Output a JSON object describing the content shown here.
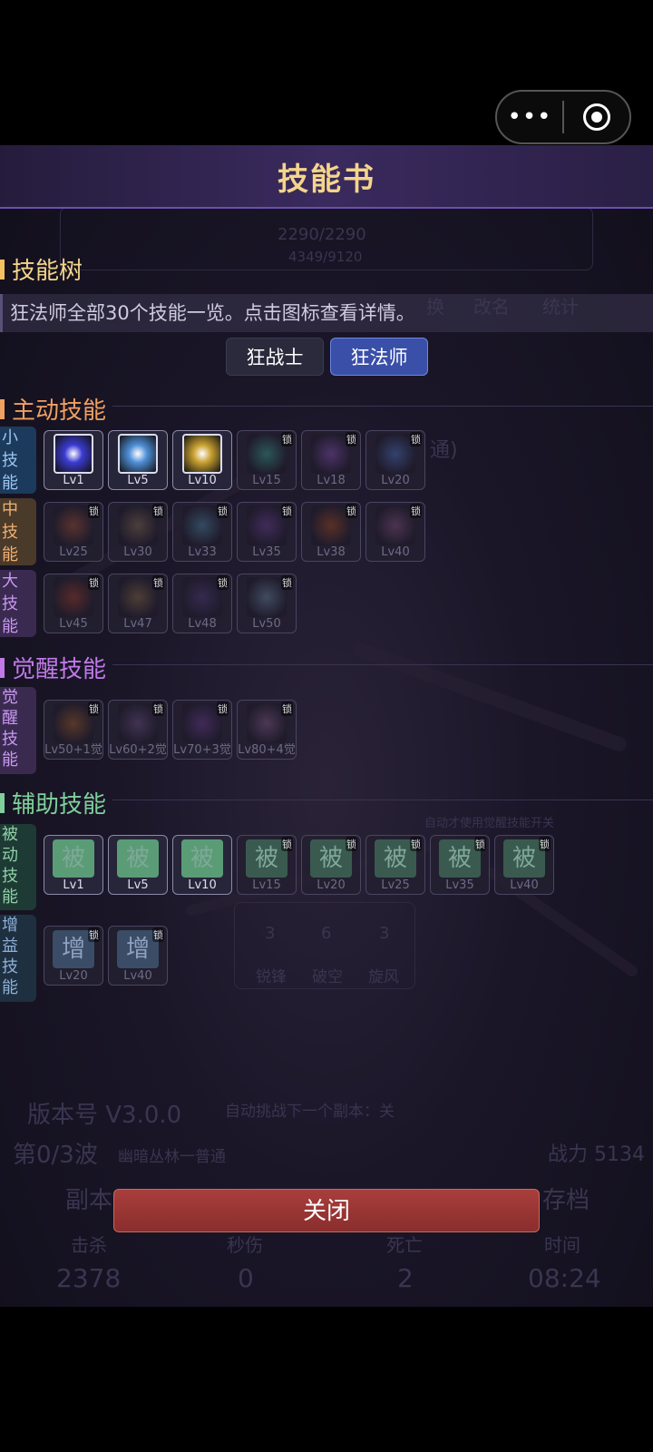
{
  "capsule": {
    "more": "•••"
  },
  "header": {
    "title": "技能书"
  },
  "tree": {
    "title": "技能树",
    "description": "狂法师全部30个技能一览。点击图标查看详情。",
    "classes": [
      "狂战士",
      "狂法师"
    ],
    "selected_class": "狂法师"
  },
  "sections": {
    "active": {
      "title": "主动技能",
      "color": "#f0a060"
    },
    "awaken": {
      "title": "觉醒技能",
      "color": "#c07ae8"
    },
    "support": {
      "title": "辅助技能",
      "color": "#7fd09a"
    }
  },
  "rows": {
    "small": {
      "label": "小\n技\n能"
    },
    "medium": {
      "label": "中\n技\n能"
    },
    "large": {
      "label": "大\n技\n能"
    },
    "awaken": {
      "label": "觉\n醒\n技\n能"
    },
    "passive": {
      "label": "被\n动\n技\n能"
    },
    "buff": {
      "label": "增\n益\n技\n能"
    }
  },
  "lock_text": "锁",
  "skills": {
    "small": [
      {
        "lv": "Lv1",
        "unlocked": true,
        "icon": "blue-claw-icon",
        "color": "#3a3bd0"
      },
      {
        "lv": "Lv5",
        "unlocked": true,
        "icon": "ice-shard-icon",
        "color": "#4f8fd8"
      },
      {
        "lv": "Lv10",
        "unlocked": true,
        "icon": "lightning-icon",
        "color": "#c8a030"
      },
      {
        "lv": "Lv15",
        "unlocked": false,
        "icon": "vortex-icon",
        "color": "#2f6a66"
      },
      {
        "lv": "Lv18",
        "unlocked": false,
        "icon": "purple-burst-icon",
        "color": "#5b3a7a"
      },
      {
        "lv": "Lv20",
        "unlocked": false,
        "icon": "comet-icon",
        "color": "#3a4e82"
      }
    ],
    "medium": [
      {
        "lv": "Lv25",
        "unlocked": false,
        "icon": "fire-orb-icon",
        "color": "#6a3a30"
      },
      {
        "lv": "Lv30",
        "unlocked": false,
        "icon": "spike-burst-icon",
        "color": "#5a4a40"
      },
      {
        "lv": "Lv33",
        "unlocked": false,
        "icon": "whirlwind-icon",
        "color": "#3a5870"
      },
      {
        "lv": "Lv35",
        "unlocked": false,
        "icon": "dark-slash-icon",
        "color": "#4a3068"
      },
      {
        "lv": "Lv38",
        "unlocked": false,
        "icon": "flame-icon",
        "color": "#6a3624"
      },
      {
        "lv": "Lv40",
        "unlocked": false,
        "icon": "spiral-icon",
        "color": "#5a3a5a"
      }
    ],
    "large": [
      {
        "lv": "Lv45",
        "unlocked": false,
        "icon": "fire-ring-icon",
        "color": "#6a2e28"
      },
      {
        "lv": "Lv47",
        "unlocked": false,
        "icon": "meteor-icon",
        "color": "#5c4838"
      },
      {
        "lv": "Lv48",
        "unlocked": false,
        "icon": "shadow-orb-icon",
        "color": "#3a2e5a"
      },
      {
        "lv": "Lv50",
        "unlocked": false,
        "icon": "frost-nova-icon",
        "color": "#4a5a70"
      }
    ],
    "awaken": [
      {
        "lv": "Lv50+1觉",
        "unlocked": false,
        "icon": "blade-storm-icon",
        "color": "#6a4028"
      },
      {
        "lv": "Lv60+2觉",
        "unlocked": false,
        "icon": "demon-mask-icon",
        "color": "#4a3a5e"
      },
      {
        "lv": "Lv70+3觉",
        "unlocked": false,
        "icon": "arcane-rune-icon",
        "color": "#4a2e66"
      },
      {
        "lv": "Lv80+4觉",
        "unlocked": false,
        "icon": "phoenix-icon",
        "color": "#5a4060"
      }
    ],
    "passive": [
      {
        "lv": "Lv1",
        "unlocked": true,
        "text": "被"
      },
      {
        "lv": "Lv5",
        "unlocked": true,
        "text": "被"
      },
      {
        "lv": "Lv10",
        "unlocked": true,
        "text": "被"
      },
      {
        "lv": "Lv15",
        "unlocked": false,
        "text": "被"
      },
      {
        "lv": "Lv20",
        "unlocked": false,
        "text": "被"
      },
      {
        "lv": "Lv25",
        "unlocked": false,
        "text": "被"
      },
      {
        "lv": "Lv35",
        "unlocked": false,
        "text": "被"
      },
      {
        "lv": "Lv40",
        "unlocked": false,
        "text": "被"
      }
    ],
    "buff": [
      {
        "lv": "Lv20",
        "unlocked": false,
        "text": "增"
      },
      {
        "lv": "Lv40",
        "unlocked": false,
        "text": "增"
      }
    ]
  },
  "background_ui": {
    "hp": "2290/2290",
    "exp": "4349/9120",
    "tabs": [
      "换",
      "改名",
      "统计"
    ],
    "dungeon_hint": "通)",
    "awaken_switch": "自动才使用觉醒技能开关",
    "mini_skills": [
      {
        "count": "3",
        "name": "锐锋"
      },
      {
        "count": "6",
        "name": "破空"
      },
      {
        "count": "3",
        "name": "旋风"
      }
    ],
    "version": "版本号 V3.0.0",
    "auto_challenge": "自动挑战下一个副本：关",
    "wave": "第0/3波",
    "wave_place": "幽暗丛林一普通",
    "power": "战力 5134",
    "buttons": [
      "副本",
      "存档"
    ],
    "stat_labels": [
      "击杀",
      "秒伤",
      "死亡",
      "时间"
    ],
    "stat_values": [
      "2378",
      "0",
      "2",
      "08:24"
    ]
  },
  "close_label": "关闭"
}
